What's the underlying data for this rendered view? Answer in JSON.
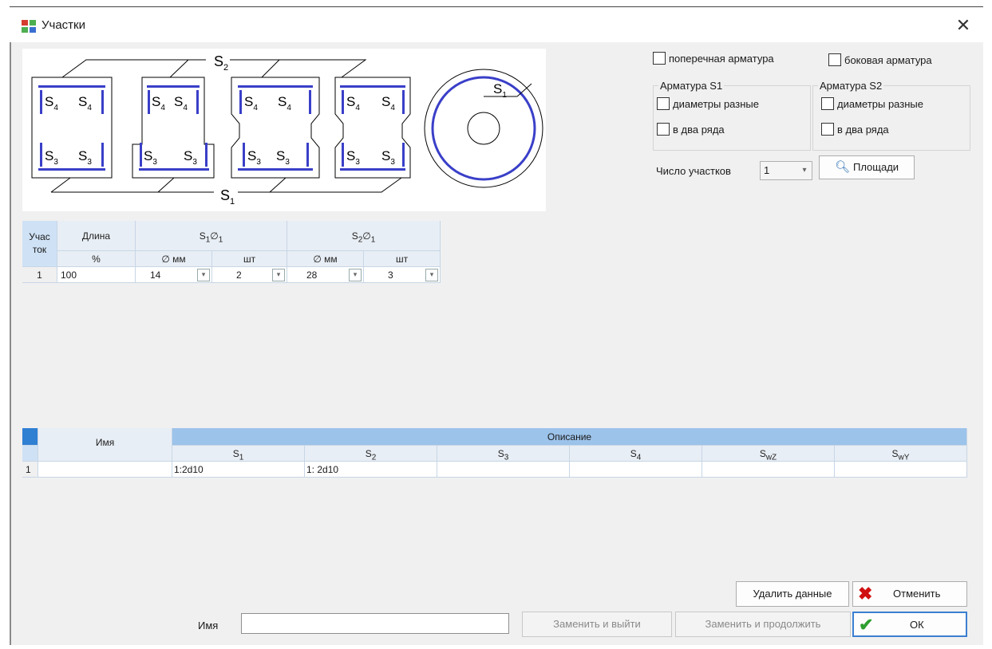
{
  "window": {
    "title": "Участки",
    "close_symbol": "✕"
  },
  "diagram": {
    "labels": {
      "s1": "S",
      "s1_sub": "1",
      "s2": "S",
      "s2_sub": "2",
      "s3": "S",
      "s3_sub": "3",
      "s4": "S",
      "s4_sub": "4"
    }
  },
  "options": {
    "transverse": "поперечная арматура",
    "side": "боковая арматура",
    "group1_title": "Арматура S1",
    "group2_title": "Арматура S2",
    "diff_diam": "диаметры разные",
    "two_rows": "в два ряда",
    "count_label": "Число участков",
    "count_value": "1",
    "areas_button": "Площади"
  },
  "table1": {
    "h_section": "Учас ток",
    "h_length": "Длина",
    "h_s1": "S",
    "h_s1_sub": "1",
    "h_s2": "S",
    "h_s2_sub": "2",
    "h_diam_sym": "∅",
    "h_diam_sub": "1",
    "h_percent": "%",
    "h_mm": "∅ мм",
    "h_pcs": "шт",
    "rows": [
      {
        "n": "1",
        "length": "100",
        "s1_mm": "14",
        "s1_pcs": "2",
        "s2_mm": "28",
        "s2_pcs": "3"
      }
    ]
  },
  "table2": {
    "h_name": "Имя",
    "h_description": "Описание",
    "cols": [
      {
        "label": "S",
        "sub": "1"
      },
      {
        "label": "S",
        "sub": "2"
      },
      {
        "label": "S",
        "sub": "3"
      },
      {
        "label": "S",
        "sub": "4"
      },
      {
        "label": "S",
        "sub": "wZ"
      },
      {
        "label": "S",
        "sub": "wY"
      }
    ],
    "rows": [
      {
        "n": "1",
        "name": "",
        "s1": "1:2d10",
        "s2": "1: 2d10",
        "s3": "",
        "s4": "",
        "swz": "",
        "swy": ""
      }
    ]
  },
  "footer": {
    "name_label": "Имя",
    "name_value": "",
    "replace_exit": "Заменить и выйти",
    "replace_continue": "Заменить и продолжить",
    "delete_data": "Удалить данные",
    "cancel": "Отменить",
    "ok": "ОК"
  },
  "colors": {
    "accent_blue": "#3a3fc8",
    "header_blue": "#9cc3ea",
    "cancel_red": "#d01010",
    "ok_green": "#2e9e2e"
  }
}
